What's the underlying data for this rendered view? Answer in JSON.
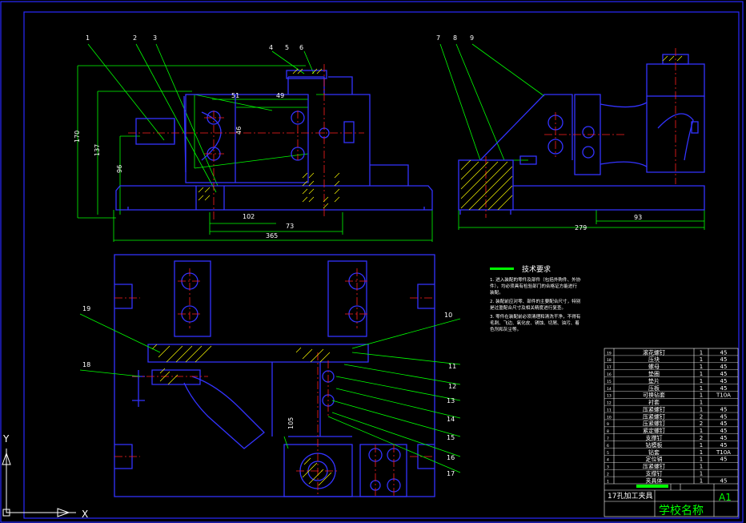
{
  "colors": {
    "background": "#000000",
    "border": "#2a2aff",
    "part": "#3333ff",
    "dimension": "#00ff00",
    "centerline": "#ff2020",
    "hatch": "#ffff00",
    "text": "#ffffff",
    "title_text": "#00ff00",
    "table_line": "#ffffff"
  },
  "balloons": {
    "top_view": [
      "1",
      "2",
      "3",
      "4",
      "5",
      "6"
    ],
    "side_view": [
      "7",
      "8",
      "9"
    ],
    "plan_left": [
      "19",
      "18"
    ],
    "plan_right": [
      "10",
      "11",
      "12",
      "13",
      "14",
      "15",
      "16",
      "17"
    ]
  },
  "dimensions": {
    "front": [
      "51",
      "49",
      "46",
      "102",
      "73",
      "365",
      "170",
      "137",
      "96"
    ],
    "side": [
      "93",
      "279"
    ],
    "plan": [
      "105"
    ]
  },
  "tech_notes": {
    "title": "技术要求",
    "lines": [
      "1. 进入装配的零件及部件（包括外购件、外协",
      "件），均必须具有检验部门的合格证方能进行",
      "装配。",
      "2. 装配前应对零、部件的主要配合尺寸，特别",
      "是过盈配合尺寸及相关精度进行复查。",
      "3. 零件在装配前必须清理和清洗干净，不得有",
      "毛刺、飞边、氧化皮、锈蚀、切屑、油污、着",
      "色剂和灰尘等。"
    ]
  },
  "bom": {
    "rows": [
      {
        "no": "19",
        "name": "滚花螺钉",
        "qty": "1",
        "material": "45"
      },
      {
        "no": "18",
        "name": "压块",
        "qty": "1",
        "material": "45"
      },
      {
        "no": "17",
        "name": "螺母",
        "qty": "1",
        "material": "45"
      },
      {
        "no": "16",
        "name": "垫圈",
        "qty": "1",
        "material": "45"
      },
      {
        "no": "15",
        "name": "垫片",
        "qty": "1",
        "material": "45"
      },
      {
        "no": "14",
        "name": "压板",
        "qty": "1",
        "material": "45"
      },
      {
        "no": "13",
        "name": "可换钻套",
        "qty": "1",
        "material": "T10A"
      },
      {
        "no": "12",
        "name": "衬套",
        "qty": "1",
        "material": ""
      },
      {
        "no": "11",
        "name": "压紧螺钉",
        "qty": "1",
        "material": "45"
      },
      {
        "no": "10",
        "name": "压紧螺钉",
        "qty": "2",
        "material": "45"
      },
      {
        "no": "9",
        "name": "压紧螺钉",
        "qty": "2",
        "material": "45"
      },
      {
        "no": "8",
        "name": "紧定螺钉",
        "qty": "1",
        "material": "45"
      },
      {
        "no": "7",
        "name": "支撑钉",
        "qty": "2",
        "material": "45"
      },
      {
        "no": "6",
        "name": "钻模板",
        "qty": "1",
        "material": "45"
      },
      {
        "no": "5",
        "name": "钻套",
        "qty": "1",
        "material": "T10A"
      },
      {
        "no": "4",
        "name": "定位销",
        "qty": "1",
        "material": "45"
      },
      {
        "no": "3",
        "name": "压紧螺钉",
        "qty": "1",
        "material": ""
      },
      {
        "no": "2",
        "name": "支撑钉",
        "qty": "1",
        "material": ""
      },
      {
        "no": "1",
        "name": "夹具体",
        "qty": "1",
        "material": "45"
      }
    ],
    "drawing_title": "17孔加工夹具",
    "school": "学校名称",
    "sheet_size": "A1"
  },
  "ucs": {
    "x_label": "X",
    "y_label": "Y"
  }
}
